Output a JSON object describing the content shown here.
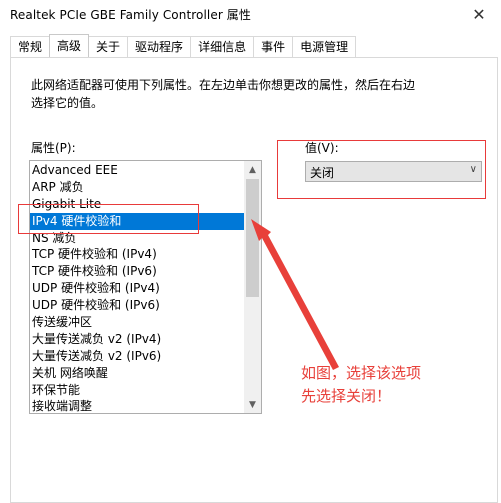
{
  "window": {
    "title": "Realtek PCIe GBE Family Controller 属性",
    "close_glyph": "✕"
  },
  "tabs": [
    {
      "label": "常规",
      "active": false
    },
    {
      "label": "高级",
      "active": true
    },
    {
      "label": "关于",
      "active": false
    },
    {
      "label": "驱动程序",
      "active": false
    },
    {
      "label": "详细信息",
      "active": false
    },
    {
      "label": "事件",
      "active": false
    },
    {
      "label": "电源管理",
      "active": false
    }
  ],
  "advanced": {
    "description_line1": "此网络适配器可使用下列属性。在左边单击你想更改的属性，然后在右边",
    "description_line2": "选择它的值。",
    "property_label": "属性(P):",
    "value_label": "值(V):",
    "properties": [
      "Advanced EEE",
      "ARP 减负",
      "Gigabit Lite",
      "IPv4 硬件校验和",
      "NS 减负",
      "TCP 硬件校验和 (IPv4)",
      "TCP 硬件校验和 (IPv6)",
      "UDP 硬件校验和 (IPv4)",
      "UDP 硬件校验和 (IPv6)",
      "传送缓冲区",
      "大量传送减负 v2 (IPv4)",
      "大量传送减负 v2 (IPv6)",
      "关机 网络唤醒",
      "环保节能",
      "接收端调整"
    ],
    "selected_index": 3,
    "selected_value": "关闭"
  },
  "annotation": {
    "line1": "如图，选择该选项",
    "line2": "先选择关闭！",
    "color": "#e8403a"
  },
  "icons": {
    "scroll_up": "▲",
    "scroll_down": "▼",
    "dropdown": "∨"
  },
  "colors": {
    "selection": "#0078d7",
    "annotation_red": "#e8403a"
  }
}
